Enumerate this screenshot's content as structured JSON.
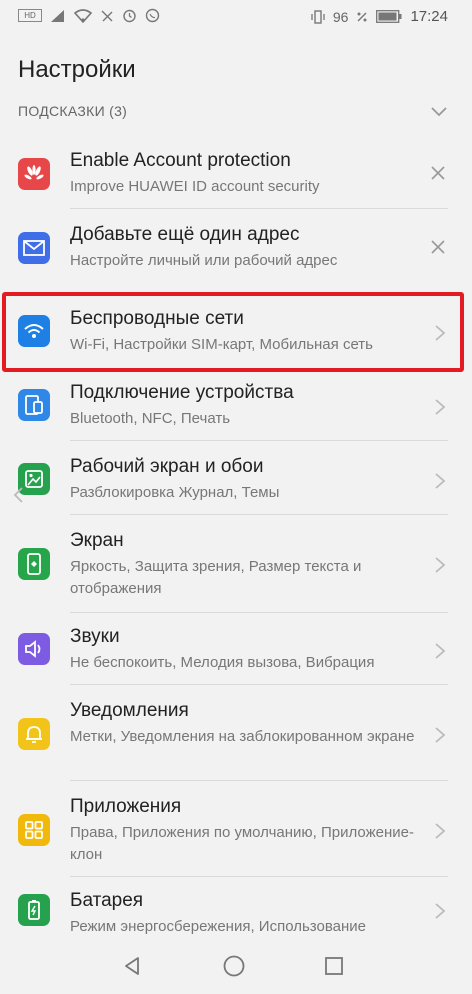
{
  "status_bar": {
    "left_icons": [
      "sim-icon",
      "signal-icon",
      "wifi-icon",
      "no-disturb-icon",
      "alarm-icon",
      "whatsapp-icon"
    ],
    "battery_level": "96",
    "time": "17:24"
  },
  "header": {
    "title": "Настройки"
  },
  "tips": {
    "label": "ПОДСКАЗКИ (3)"
  },
  "items": [
    {
      "title": "Enable Account protection",
      "subtitle": "Improve HUAWEI ID account security",
      "icon": "huawei-icon",
      "icon_color": "#e8474a",
      "action": "close"
    },
    {
      "title": "Добавьте ещё один адрес",
      "subtitle": "Настройте личный или рабочий адрес",
      "icon": "mail-icon",
      "icon_color": "#3f6ee8",
      "action": "close"
    },
    {
      "title": "Беспроводные сети",
      "subtitle": "Wi-Fi, Настройки SIM-карт, Мобильная сеть",
      "icon": "wifi-icon",
      "icon_color": "#1e7fe4",
      "action": "arrow"
    },
    {
      "title": "Подключение устройства",
      "subtitle": "Bluetooth, NFC, Печать",
      "icon": "device-icon",
      "icon_color": "#2f87e7",
      "action": "arrow"
    },
    {
      "title": "Рабочий экран и обои",
      "subtitle": "Разблокировка Журнал, Темы",
      "icon": "wallpaper-icon",
      "icon_color": "#26a24f",
      "action": "arrow"
    },
    {
      "title": "Экран",
      "subtitle": "Яркость, Защита зрения, Размер текста и отображения",
      "icon": "display-icon",
      "icon_color": "#27a54b",
      "action": "arrow"
    },
    {
      "title": "Звуки",
      "subtitle": "Не беспокоить, Мелодия вызова, Вибрация",
      "icon": "sound-icon",
      "icon_color": "#7d5be3",
      "action": "arrow"
    },
    {
      "title": "Уведомления",
      "subtitle": "Метки, Уведомления на заблокированном экране",
      "icon": "bell-icon",
      "icon_color": "#f2c41a",
      "action": "arrow"
    },
    {
      "title": "Приложения",
      "subtitle": "Права, Приложения по умолчанию, Приложение-клон",
      "icon": "apps-icon",
      "icon_color": "#f0b90c",
      "action": "arrow"
    },
    {
      "title": "Батарея",
      "subtitle": "Режим энергосбережения, Использование",
      "icon": "battery-icon",
      "icon_color": "#26a24f",
      "action": "arrow"
    }
  ],
  "nav": {
    "back": "back-icon",
    "home": "home-icon",
    "recents": "recents-icon"
  },
  "colors": {
    "highlight": "#e31b23"
  }
}
